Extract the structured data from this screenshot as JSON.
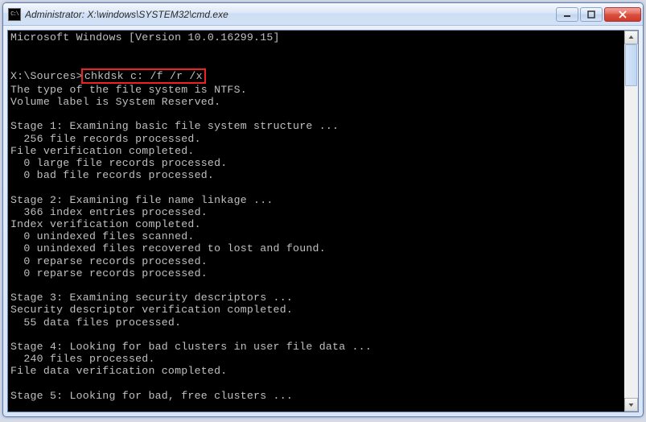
{
  "titlebar": {
    "icon_label": "C:\\",
    "title": "Administrator: X:\\windows\\SYSTEM32\\cmd.exe"
  },
  "controls": {
    "minimize": "minimize",
    "maximize": "maximize",
    "close": "close"
  },
  "console": {
    "header": "Microsoft Windows [Version 10.0.16299.15]",
    "prompt": "X:\\Sources>",
    "command": "chkdsk c: /f /r /x",
    "lines": [
      "The type of the file system is NTFS.",
      "Volume label is System Reserved.",
      "",
      "Stage 1: Examining basic file system structure ...",
      "  256 file records processed.",
      "File verification completed.",
      "  0 large file records processed.",
      "  0 bad file records processed.",
      "",
      "Stage 2: Examining file name linkage ...",
      "  366 index entries processed.",
      "Index verification completed.",
      "  0 unindexed files scanned.",
      "  0 unindexed files recovered to lost and found.",
      "  0 reparse records processed.",
      "  0 reparse records processed.",
      "",
      "Stage 3: Examining security descriptors ...",
      "Security descriptor verification completed.",
      "  55 data files processed.",
      "",
      "Stage 4: Looking for bad clusters in user file data ...",
      "  240 files processed.",
      "File data verification completed.",
      "",
      "Stage 5: Looking for bad, free clusters ..."
    ]
  }
}
